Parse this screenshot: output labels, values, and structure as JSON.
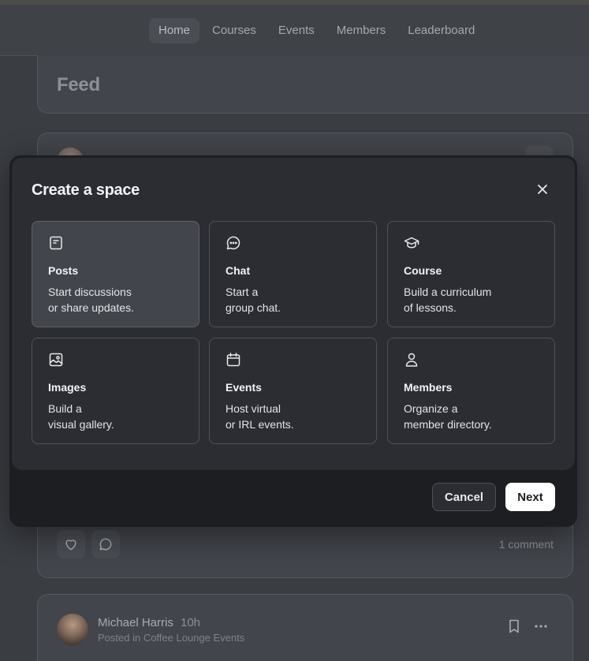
{
  "nav": {
    "tabs": [
      {
        "label": "Home",
        "active": true
      },
      {
        "label": "Courses"
      },
      {
        "label": "Events"
      },
      {
        "label": "Members"
      },
      {
        "label": "Leaderboard"
      }
    ]
  },
  "feed": {
    "title": "Feed"
  },
  "post1": {
    "comment_count": "1 comment"
  },
  "post2": {
    "author": "Michael Harris",
    "time": "10h",
    "posted_in": "Posted in Coffee Lounge Events"
  },
  "modal": {
    "title": "Create a space",
    "options": [
      {
        "icon": "posts-icon",
        "title": "Posts",
        "desc1": "Start discussions",
        "desc2": "or share updates.",
        "selected": true
      },
      {
        "icon": "chat-icon",
        "title": "Chat",
        "desc1": "Start a",
        "desc2": "group chat."
      },
      {
        "icon": "course-icon",
        "title": "Course",
        "desc1": "Build a curriculum",
        "desc2": "of lessons."
      },
      {
        "icon": "images-icon",
        "title": "Images",
        "desc1": "Build a",
        "desc2": "visual gallery."
      },
      {
        "icon": "calendar-icon",
        "title": "Events",
        "desc1": "Host virtual",
        "desc2": "or IRL events."
      },
      {
        "icon": "person-icon",
        "title": "Members",
        "desc1": "Organize a",
        "desc2": "member directory."
      }
    ],
    "cancel_label": "Cancel",
    "next_label": "Next"
  }
}
